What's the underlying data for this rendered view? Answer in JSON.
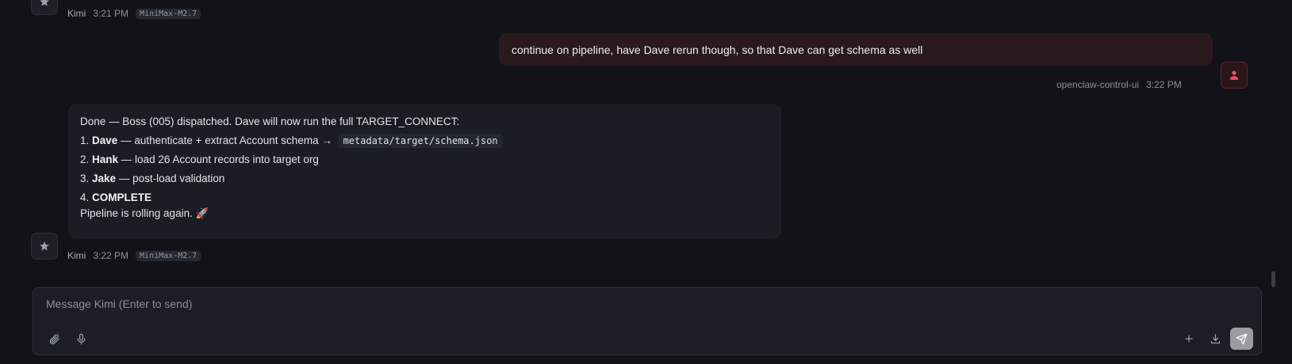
{
  "messages": {
    "top_meta": {
      "name": "Kimi",
      "time": "3:21 PM",
      "model": "MiniMax-M2.7"
    },
    "user": {
      "text": "continue on pipeline, have Dave rerun though, so that Dave can get schema as well",
      "name": "openclaw-control-ui",
      "time": "3:22 PM"
    },
    "bot": {
      "intro": "Done — Boss (005) dispatched. Dave will now run the full TARGET_CONNECT:",
      "steps": [
        {
          "num": "1.",
          "name": "Dave",
          "text": " — authenticate + extract Account schema → ",
          "code": "metadata/target/schema.json"
        },
        {
          "num": "2.",
          "name": "Hank",
          "text": " — load 26 Account records into target org"
        },
        {
          "num": "3.",
          "name": "Jake",
          "text": " — post-load validation"
        },
        {
          "num": "4.",
          "name": "COMPLETE",
          "text": ""
        }
      ],
      "outro": "Pipeline is rolling again. 🚀",
      "name": "Kimi",
      "time": "3:22 PM",
      "model": "MiniMax-M2.7"
    }
  },
  "composer": {
    "placeholder": "Message Kimi (Enter to send)",
    "value": ""
  },
  "icons": {
    "bot_avatar": "star-icon",
    "user_avatar": "user-icon",
    "attach": "paperclip-icon",
    "mic": "microphone-icon",
    "add": "plus-icon",
    "download": "download-icon",
    "send": "send-icon"
  },
  "colors": {
    "background": "#111318",
    "user_bubble": "#2a1a1e",
    "user_avatar_accent": "#e8515f",
    "bot_bubble": "#1a1d23",
    "send_button": "#9a9ca2"
  }
}
